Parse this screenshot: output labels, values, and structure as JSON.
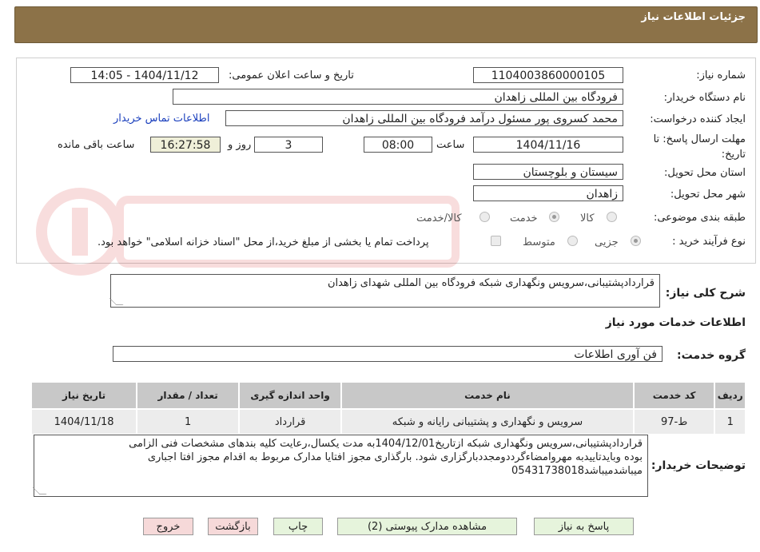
{
  "header": {
    "title": "جزئیات اطلاعات نیاز"
  },
  "fields": {
    "need_number_label": "شماره نیاز:",
    "need_number": "1104003860000105",
    "announce_label": "تاریخ و ساعت اعلان عمومی:",
    "announce_value": "1404/11/12 - 14:05",
    "buyer_org_label": "نام دستگاه خریدار:",
    "buyer_org": "فرودگاه بین المللی زاهدان",
    "requester_label": "ایجاد کننده درخواست:",
    "requester": "محمد کسروی پور مسئول درآمد فرودگاه بین المللی زاهدان",
    "contact_link": "اطلاعات تماس خریدار",
    "deadline_label": "مهلت ارسال پاسخ: تا تاریخ:",
    "deadline_date": "1404/11/16",
    "time_label": "ساعت",
    "deadline_time": "08:00",
    "days_value": "3",
    "days_label": "روز و",
    "remaining_time": "16:27:58",
    "remaining_label": "ساعت باقی مانده",
    "province_label": "استان محل تحویل:",
    "province": "سیستان و بلوچستان",
    "city_label": "شهر محل تحویل:",
    "city": "زاهدان",
    "category_label": "طبقه بندی موضوعی:",
    "category_options": [
      "کالا",
      "خدمت",
      "کالا/خدمت"
    ],
    "process_label": "نوع فرآیند خرید :",
    "process_options": [
      "جزیی",
      "متوسط"
    ],
    "payment_note": "پرداخت تمام یا بخشی از مبلغ خرید،از محل \"اسناد خزانه اسلامی\" خواهد بود."
  },
  "summary": {
    "label": "شرح کلی نیاز:",
    "value": "قراردادپشتیبانی،سرویس ونگهداری شبکه فرودگاه بین المللی شهدای زاهدان"
  },
  "services_section": {
    "title": "اطلاعات خدمات مورد نیاز",
    "group_label": "گروه خدمت:",
    "group_value": "فن آوری اطلاعات"
  },
  "table": {
    "headers": [
      "ردیف",
      "کد خدمت",
      "نام خدمت",
      "واحد اندازه گیری",
      "تعداد / مقدار",
      "تاریخ نیاز"
    ],
    "rows": [
      [
        "1",
        "ط-97",
        "سرویس و نگهداری و پشتیبانی رایانه و شبکه",
        "قرارداد",
        "1",
        "1404/11/18"
      ]
    ]
  },
  "buyer_notes": {
    "label": "توضیحات خریدار:",
    "line1": "قراردادپشتیبانی،سرویس ونگهداری شبکه ازتاریخ1404/12/01به مدت یکسال،رعایت کلیه بندهای مشخصات فنی الزامی",
    "line2": "بوده وبایدتاییدبه مهروامضاءگرددومجددبارگزاری شود. بارگذاری مجوز افتایا مدارک مربوط به اقدام مجوز افتا اجباری",
    "line3": "میباشدمیباشد05431738018"
  },
  "buttons": {
    "respond": "پاسخ به نیاز",
    "attachments": "مشاهده مدارک پیوستی (2)",
    "print": "چاپ",
    "back": "بازگشت",
    "exit": "خروج"
  },
  "colors": {
    "header_bg": "#8c7248",
    "button_bg": "#e6f4dc",
    "button_red_bg": "#f6d9d9",
    "table_header_bg": "#c8c8c8",
    "link": "#1a3fbd"
  }
}
